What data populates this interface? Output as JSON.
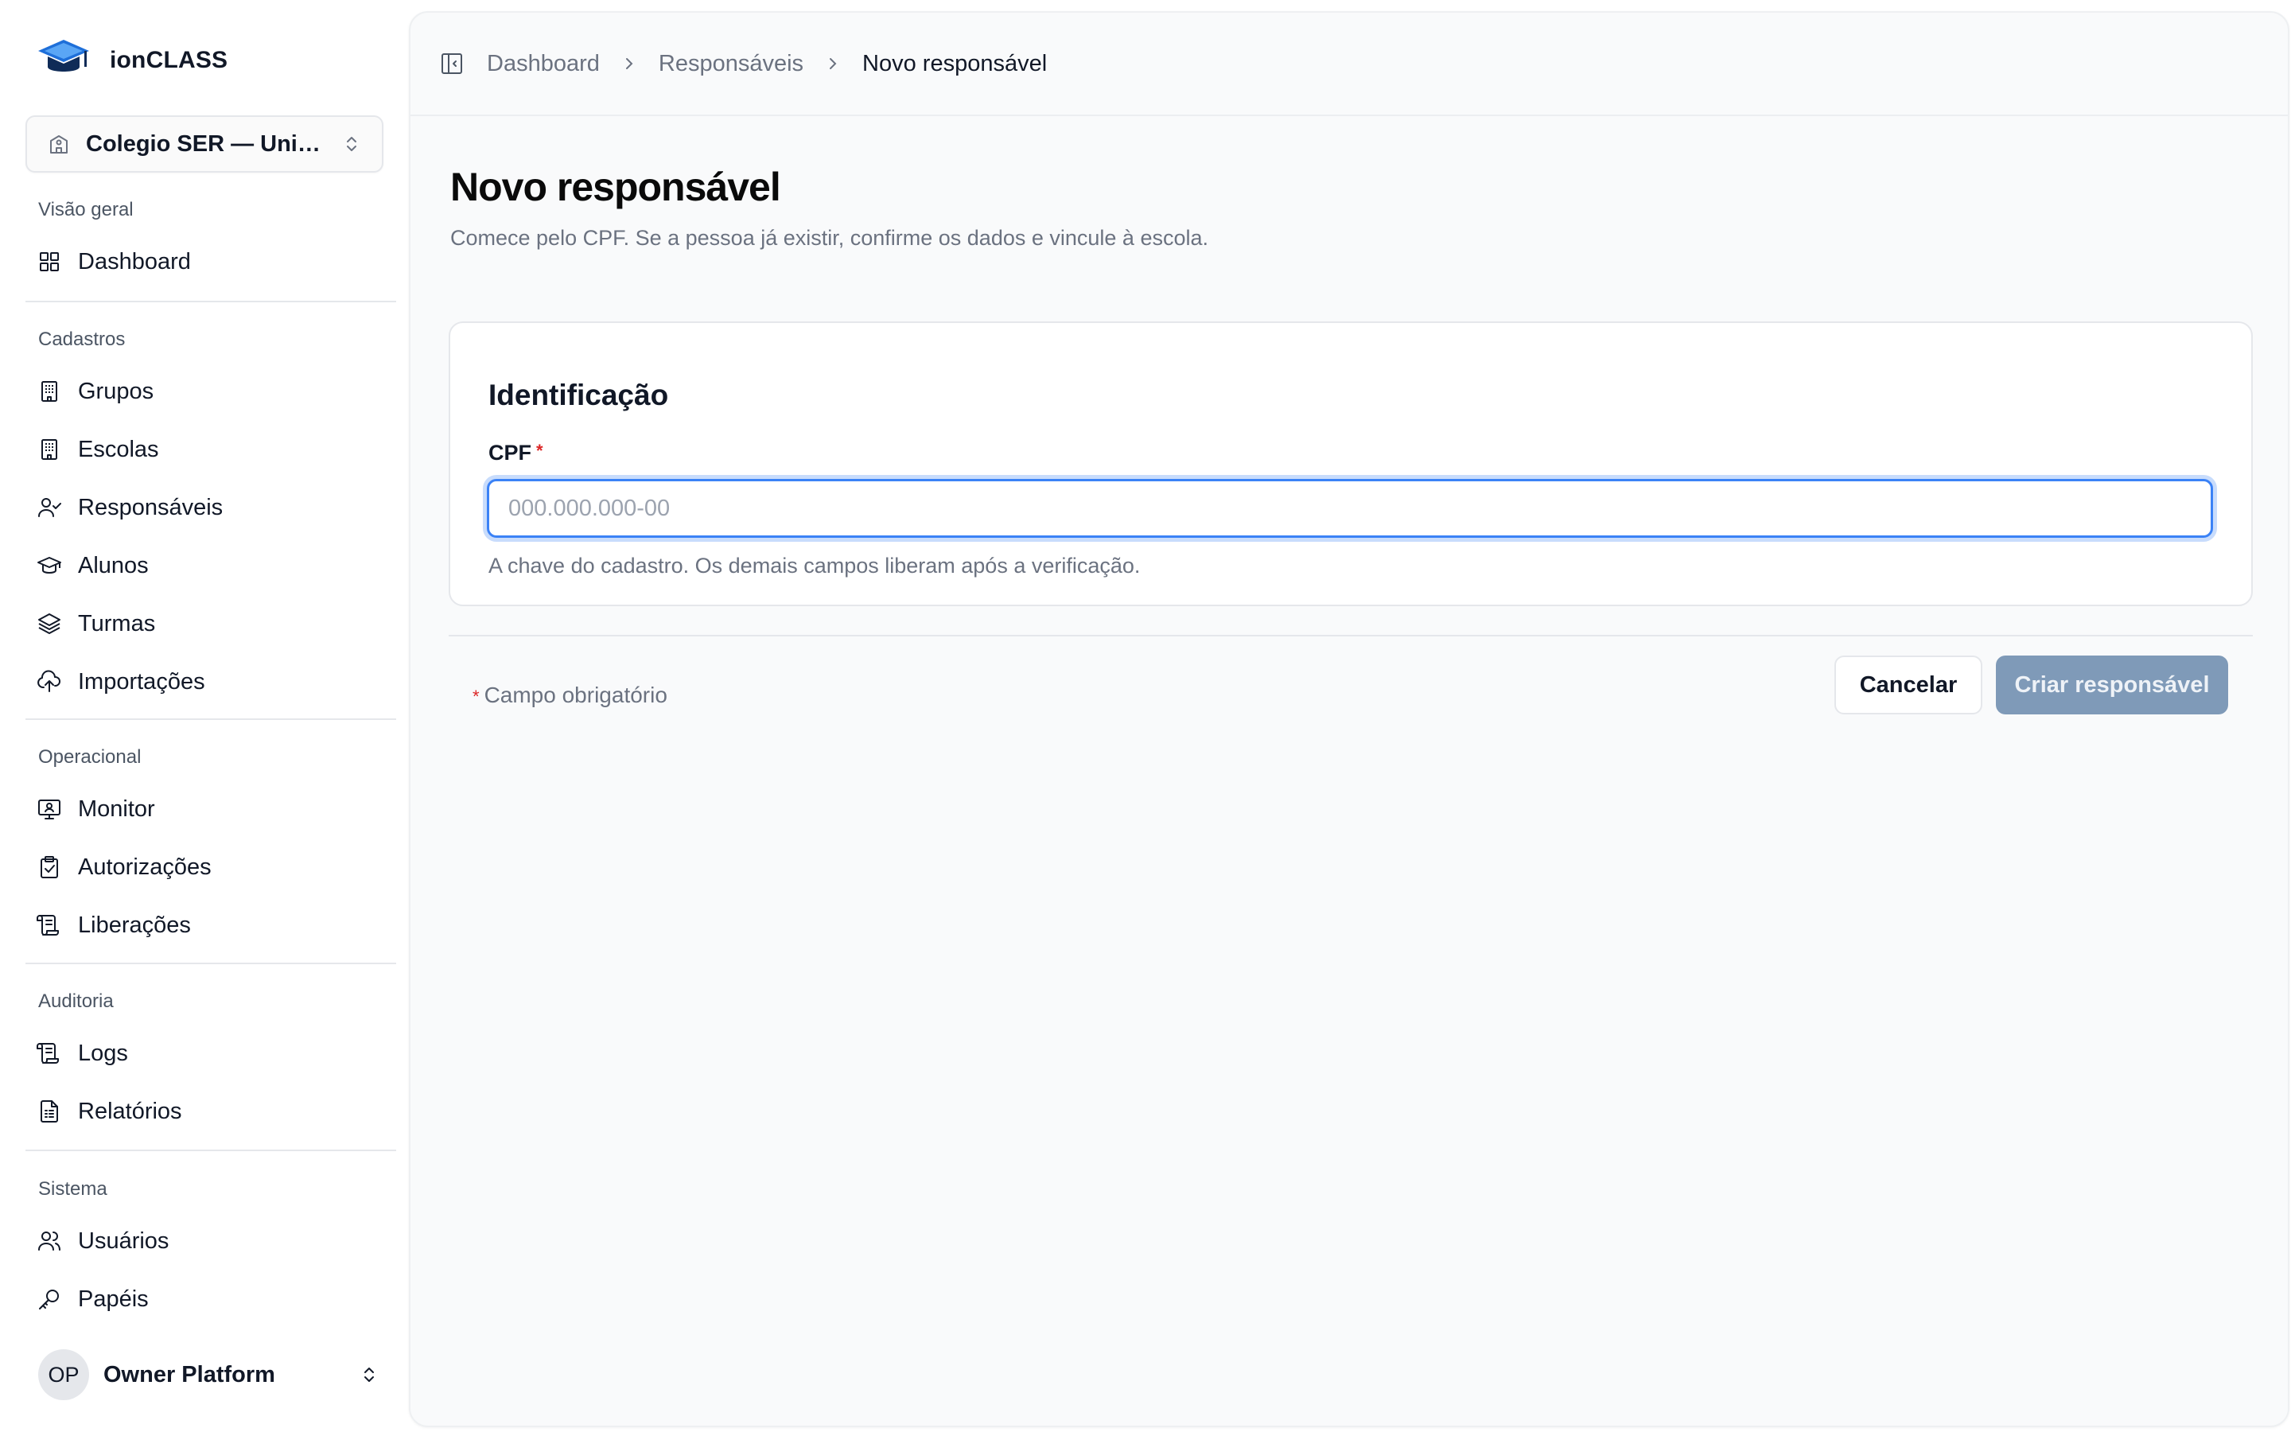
{
  "app": {
    "name": "ionCLASS"
  },
  "school_select": {
    "label": "Colegio SER — Unida..."
  },
  "nav": {
    "groups": [
      {
        "label": "Visão geral",
        "items": [
          {
            "label": "Dashboard",
            "icon": "dashboard-grid-icon"
          }
        ]
      },
      {
        "label": "Cadastros",
        "items": [
          {
            "label": "Grupos",
            "icon": "building-icon"
          },
          {
            "label": "Escolas",
            "icon": "building-icon"
          },
          {
            "label": "Responsáveis",
            "icon": "user-check-icon"
          },
          {
            "label": "Alunos",
            "icon": "graduation-cap-icon"
          },
          {
            "label": "Turmas",
            "icon": "layers-icon"
          },
          {
            "label": "Importações",
            "icon": "cloud-upload-icon"
          }
        ]
      },
      {
        "label": "Operacional",
        "items": [
          {
            "label": "Monitor",
            "icon": "monitor-icon"
          },
          {
            "label": "Autorizações",
            "icon": "clipboard-check-icon"
          },
          {
            "label": "Liberações",
            "icon": "scroll-icon"
          }
        ]
      },
      {
        "label": "Auditoria",
        "items": [
          {
            "label": "Logs",
            "icon": "scroll-icon"
          },
          {
            "label": "Relatórios",
            "icon": "file-text-icon"
          }
        ]
      },
      {
        "label": "Sistema",
        "items": [
          {
            "label": "Usuários",
            "icon": "users-icon"
          },
          {
            "label": "Papéis",
            "icon": "key-icon"
          }
        ]
      }
    ]
  },
  "user": {
    "initials": "OP",
    "name": "Owner Platform"
  },
  "breadcrumb": {
    "items": [
      "Dashboard",
      "Responsáveis",
      "Novo responsável"
    ]
  },
  "page": {
    "title": "Novo responsável",
    "subtitle": "Comece pelo CPF. Se a pessoa já existir, confirme os dados e vincule à escola."
  },
  "form": {
    "section_title": "Identificação",
    "cpf_label": "CPF",
    "required_mark": "*",
    "cpf_value": "",
    "cpf_placeholder": "000.000.000-00",
    "cpf_help": "A chave do cadastro. Os demais campos liberam após a verificação."
  },
  "footer": {
    "required_note": "Campo obrigatório",
    "cancel_label": "Cancelar",
    "create_label": "Criar responsável"
  },
  "colors": {
    "accent": "#3b82f6",
    "create_button": "#7f9ab8",
    "required": "#dc2626"
  }
}
